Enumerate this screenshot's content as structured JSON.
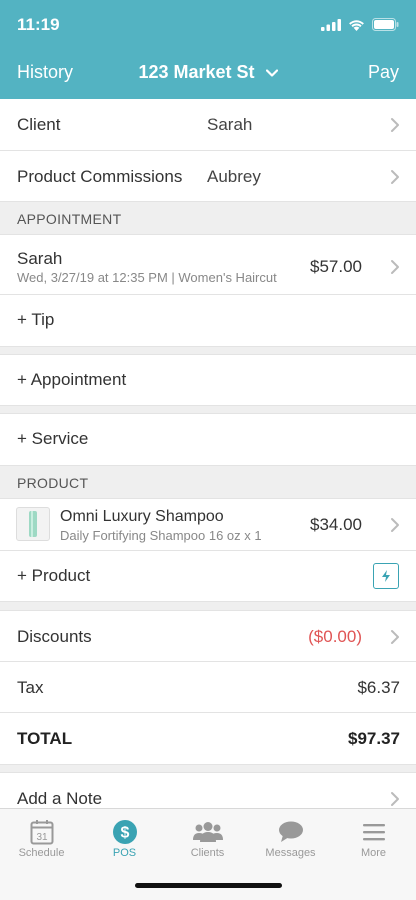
{
  "status": {
    "time": "11:19"
  },
  "nav": {
    "left": "History",
    "title": "123 Market St",
    "right": "Pay"
  },
  "client": {
    "label": "Client",
    "value": "Sarah"
  },
  "commissions": {
    "label": "Product Commissions",
    "value": "Aubrey"
  },
  "appointment_section": {
    "header": "APPOINTMENT"
  },
  "appointment": {
    "name": "Sarah",
    "detail": "Wed, 3/27/19 at 12:35 PM | Women's Haircut",
    "price": "$57.00"
  },
  "tip": "+ Tip",
  "add_appointment": "+ Appointment",
  "add_service": "+ Service",
  "product_section": {
    "header": "PRODUCT"
  },
  "product": {
    "name": "Omni Luxury Shampoo",
    "detail": "Daily Fortifying Shampoo 16 oz x 1",
    "price": "$34.00"
  },
  "add_product": "+ Product",
  "discounts": {
    "label": "Discounts",
    "value": "($0.00)",
    "color": "#e05555"
  },
  "tax": {
    "label": "Tax",
    "value": "$6.37"
  },
  "total": {
    "label": "TOTAL",
    "value": "$97.37"
  },
  "note": {
    "label": "Add a Note"
  },
  "tabs": [
    {
      "label": "Schedule",
      "icon": "calendar-icon",
      "day": "31"
    },
    {
      "label": "POS",
      "icon": "dollar-icon",
      "active": true
    },
    {
      "label": "Clients",
      "icon": "people-icon"
    },
    {
      "label": "Messages",
      "icon": "chat-icon"
    },
    {
      "label": "More",
      "icon": "menu-icon"
    }
  ],
  "colors": {
    "accent": "#53b3c2",
    "link": "#3aa3b3"
  }
}
